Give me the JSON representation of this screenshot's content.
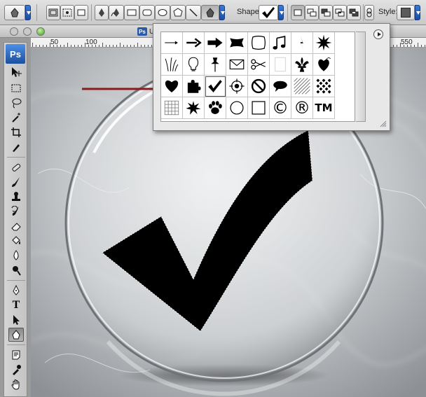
{
  "options_bar": {
    "shape_label": "Shape:",
    "style_label": "Style:",
    "tool_preset_icon": "custom-shape-icon",
    "mode_icons": [
      "shape-layers-icon",
      "paths-icon",
      "fill-pixels-icon"
    ],
    "draw_tool_icons": [
      "pen-icon",
      "freeform-pen-icon",
      "rectangle-icon",
      "rounded-rectangle-icon",
      "ellipse-icon",
      "polygon-icon",
      "line-icon",
      "custom-shape-icon"
    ],
    "combine_icons": [
      "create-new-icon",
      "add-icon",
      "subtract-icon",
      "intersect-icon",
      "exclude-icon"
    ],
    "link_icon": "link-icon"
  },
  "document": {
    "tab_title": "U",
    "app_badge": "Ps"
  },
  "ruler": {
    "labels": [
      "50",
      "100",
      "550"
    ]
  },
  "toolbox": {
    "logo": "Ps",
    "tools": [
      "move-icon",
      "marquee-icon",
      "lasso-icon",
      "magic-wand-icon",
      "crop-icon",
      "eyedropper-icon",
      "healing-brush-icon",
      "brush-icon",
      "clone-stamp-icon",
      "history-brush-icon",
      "eraser-icon",
      "paint-bucket-icon",
      "blur-icon",
      "dodge-icon",
      "pen-icon",
      "type-icon",
      "path-selection-icon",
      "custom-shape-icon",
      "notes-icon",
      "eyedropper-icon",
      "hand-icon"
    ],
    "type_label": "T"
  },
  "shape_picker": {
    "selected": "checkmark",
    "shapes": [
      "arrow-thin",
      "arrow-medium",
      "arrow-bold",
      "banner",
      "frame",
      "music-notes",
      "lightning",
      "starburst",
      "grass",
      "lightbulb",
      "pushpin",
      "envelope",
      "scissors",
      "blank-sign",
      "fleur-de-lis",
      "hearts-suit",
      "heart-card",
      "puzzle-piece",
      "checkmark",
      "target",
      "no-symbol",
      "speech-bubble",
      "hatch-pattern",
      "diamond-grid",
      "grid",
      "burst",
      "paw-print",
      "circle",
      "square",
      "copyright",
      "registered",
      "trademark"
    ],
    "glyphs": {
      "copyright": "©",
      "registered": "®",
      "trademark": "TM"
    },
    "menu_icon": "picker-menu-icon"
  },
  "colors": {
    "accent_blue": "#1d59b8",
    "annotation_arrow": "#8b1c1c"
  }
}
